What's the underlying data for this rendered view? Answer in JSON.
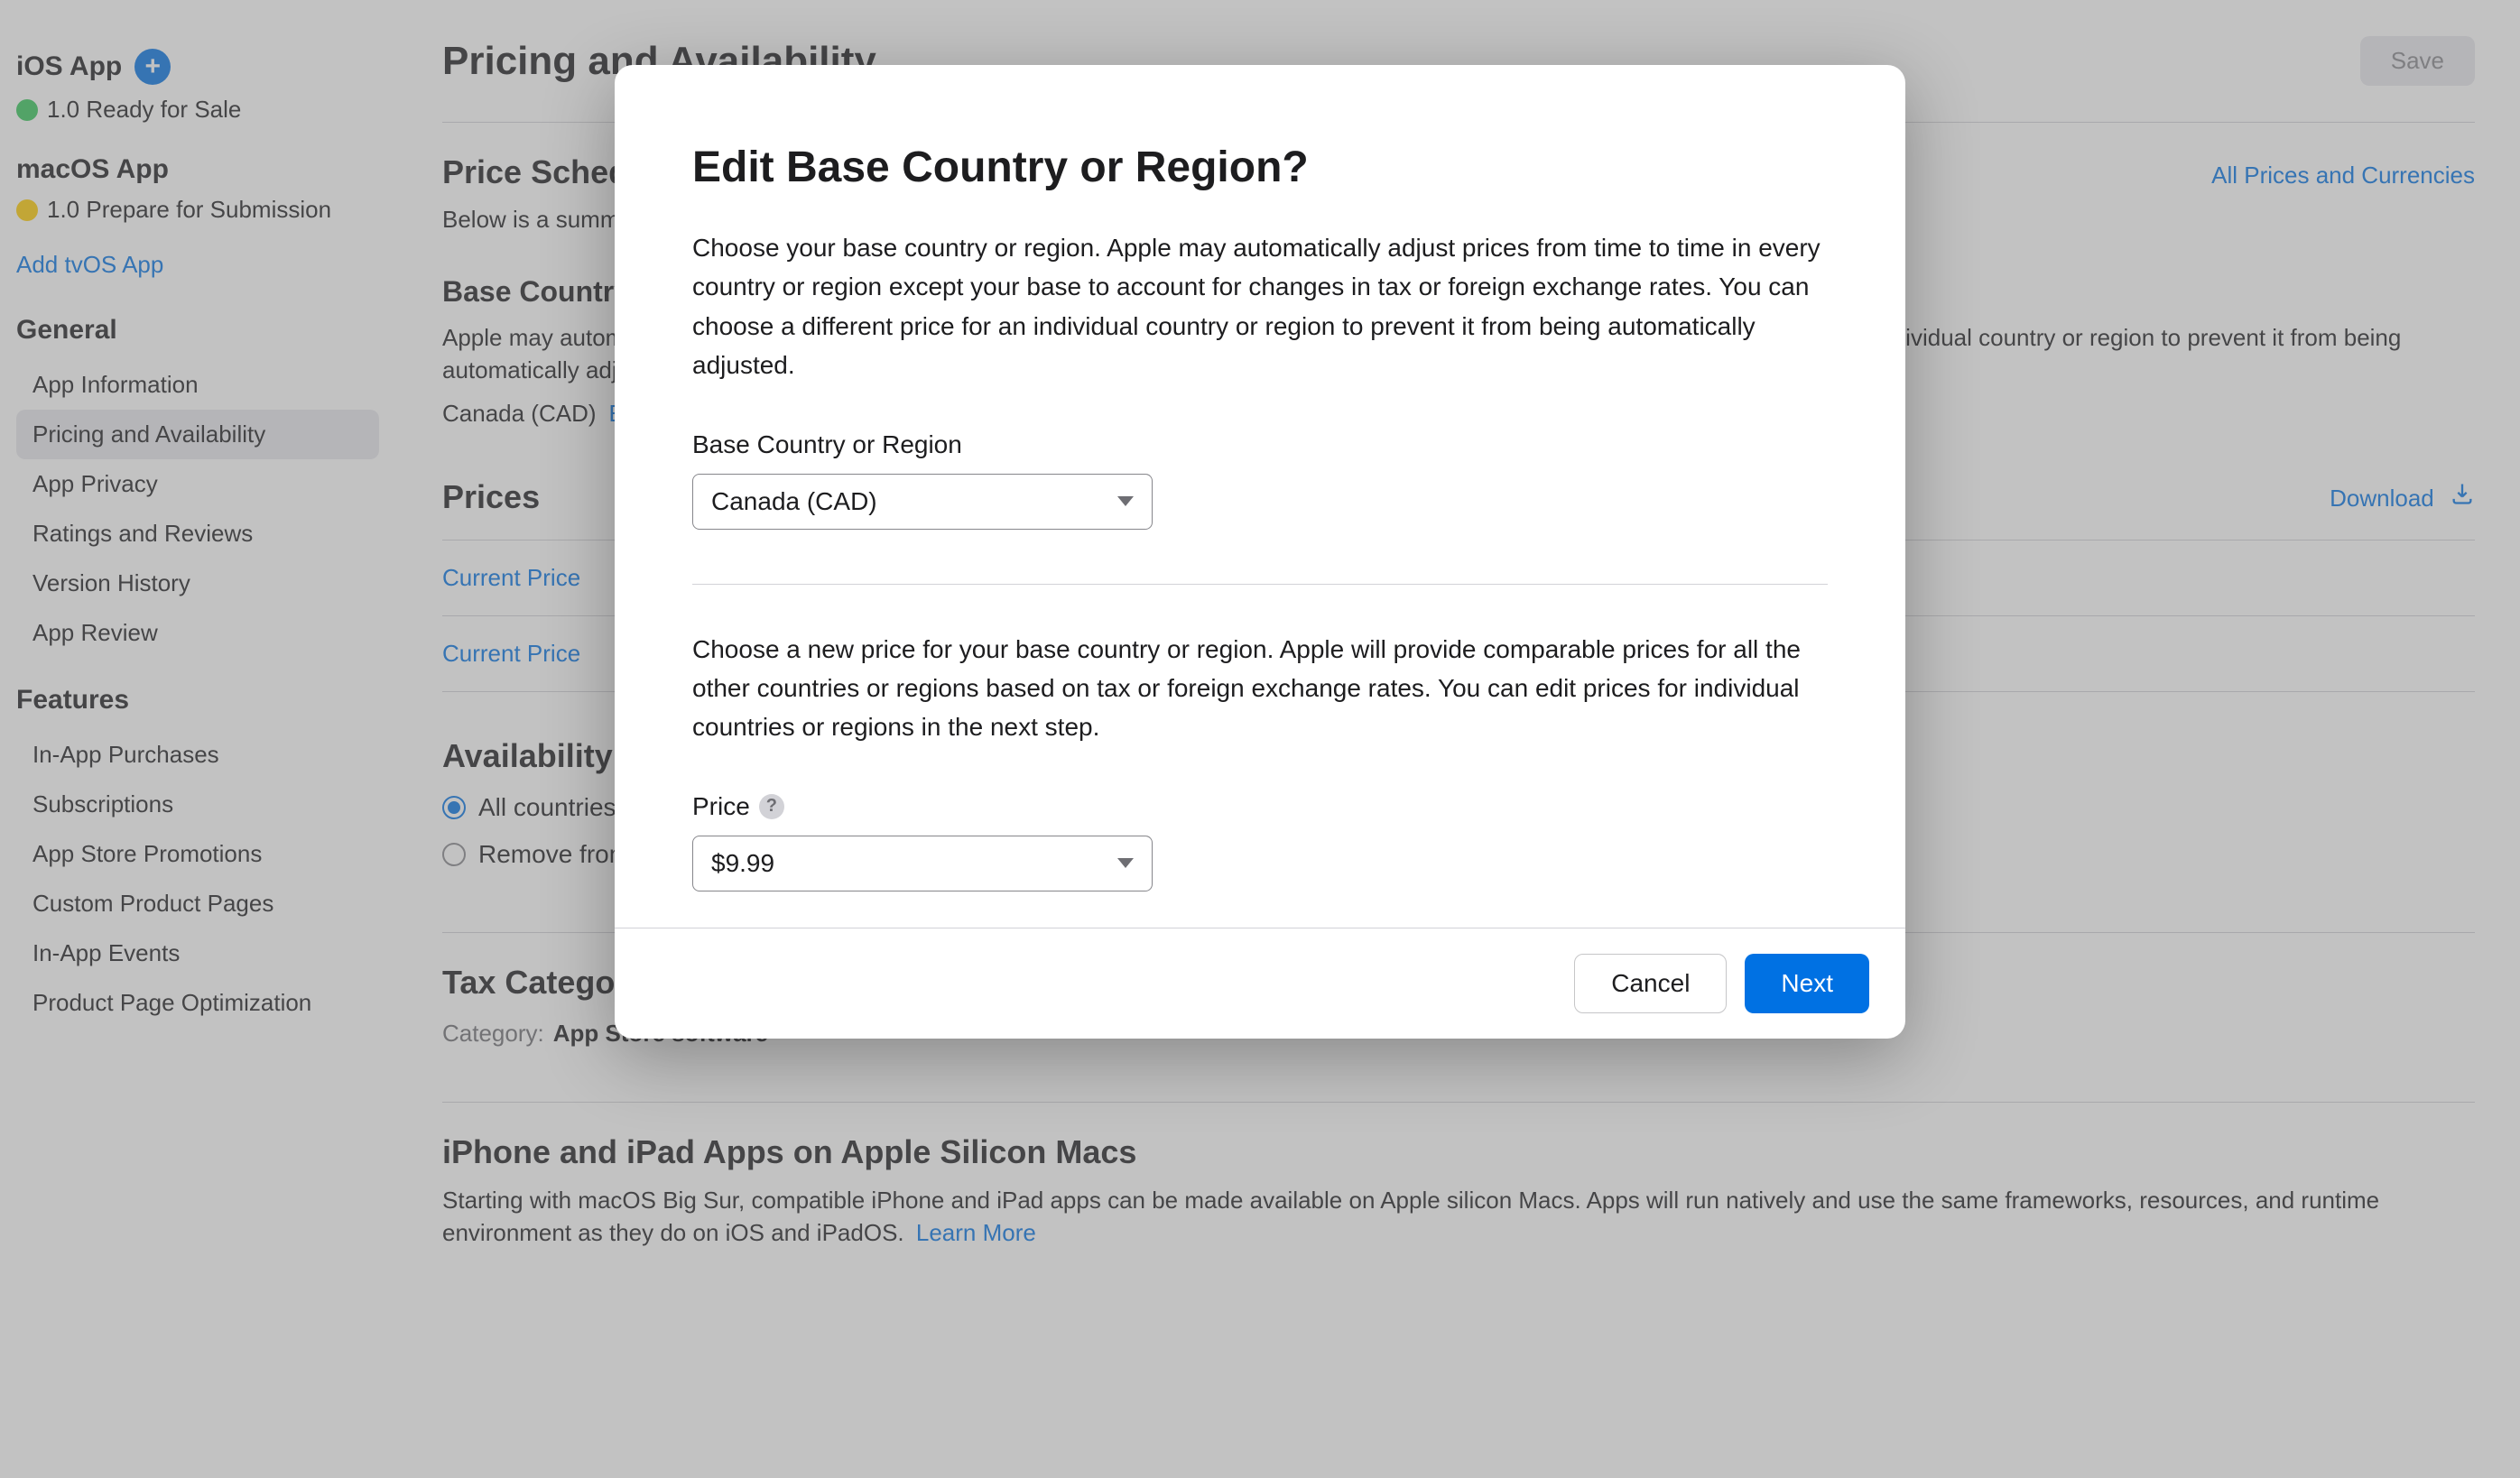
{
  "sidebar": {
    "ios": {
      "title": "iOS App",
      "status": "1.0 Ready for Sale"
    },
    "macos": {
      "title": "macOS App",
      "status": "1.0 Prepare for Submission"
    },
    "add_tvos": "Add tvOS App",
    "general": {
      "header": "General",
      "items": [
        "App Information",
        "Pricing and Availability",
        "App Privacy",
        "Ratings and Reviews",
        "Version History",
        "App Review"
      ]
    },
    "features": {
      "header": "Features",
      "items": [
        "In-App Purchases",
        "Subscriptions",
        "App Store Promotions",
        "Custom Product Pages",
        "In-App Events",
        "Product Page Optimization"
      ]
    }
  },
  "page": {
    "title": "Pricing and Availability",
    "save": "Save",
    "schedule": {
      "title": "Price Schedule",
      "all_link": "All Prices and Currencies",
      "desc_prefix": "Below is a summary of the pricing schedule for your app."
    },
    "base_region": {
      "title": "Base Country or Region",
      "desc": "Apple may automatically adjust your base to account for changes in tax or foreign exchange rates. You can choose a different price for an individual country or region to prevent it from being automatically adjusted.",
      "value": "Canada (CAD)",
      "edit": "Edit"
    },
    "prices": {
      "title": "Prices",
      "download": "Download",
      "row1": "Current Price",
      "row2": "Current Price"
    },
    "availability": {
      "title": "Availability",
      "opt1": "All countries or regions selected",
      "opt2": "Remove from sale"
    },
    "tax": {
      "title": "Tax Category",
      "label": "Category:",
      "value": "App Store software"
    },
    "mac_section": {
      "title": "iPhone and iPad Apps on Apple Silicon Macs",
      "desc": "Starting with macOS Big Sur, compatible iPhone and iPad apps can be made available on Apple silicon Macs. Apps will run natively and use the same frameworks, resources, and runtime environment as they do on iOS and iPadOS.",
      "learn": "Learn More"
    }
  },
  "modal": {
    "title": "Edit Base Country or Region?",
    "desc1": "Choose your base country or region. Apple may automatically adjust prices from time to time in every country or region except your base to account for changes in tax or foreign exchange rates. You can choose a different price for an individual country or region to prevent it from being automatically adjusted.",
    "field1_label": "Base Country or Region",
    "field1_value": "Canada (CAD)",
    "desc2": "Choose a new price for your base country or region. Apple will provide comparable prices for all the other countries or regions based on tax or foreign exchange rates. You can edit prices for individual countries or regions in the next step.",
    "field2_label": "Price",
    "field2_value": "$9.99",
    "cancel": "Cancel",
    "next": "Next"
  }
}
